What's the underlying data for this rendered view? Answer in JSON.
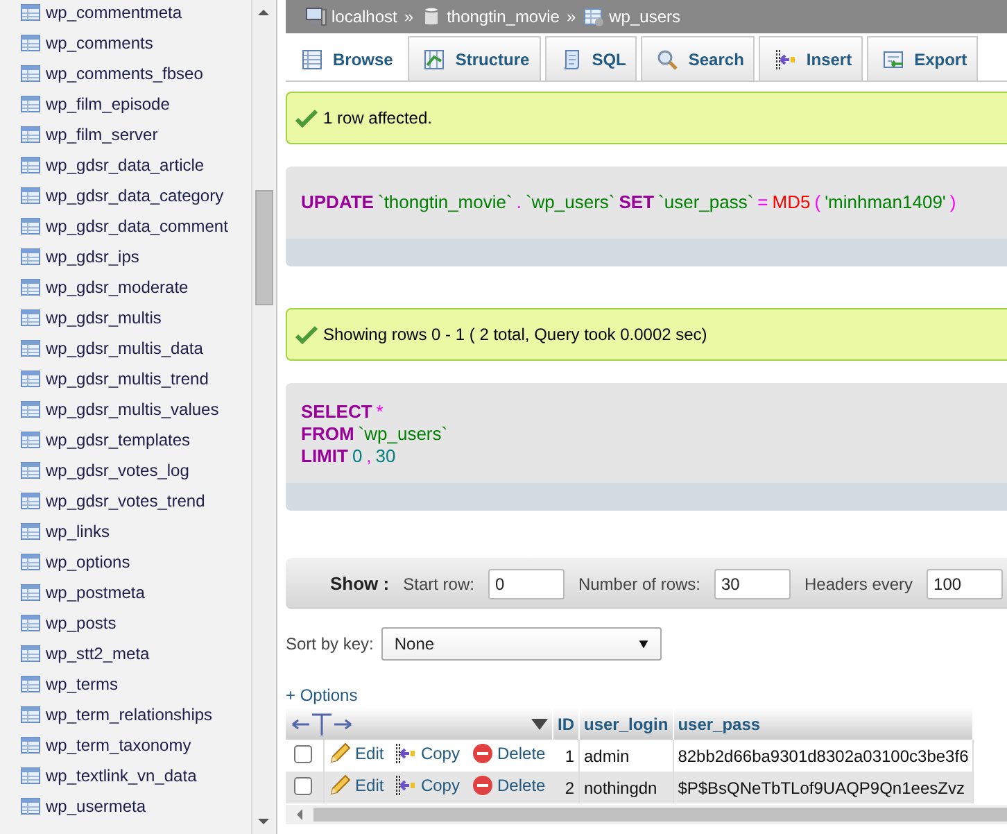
{
  "sidebar": {
    "items": [
      {
        "label": "wp_commentmeta"
      },
      {
        "label": "wp_comments"
      },
      {
        "label": "wp_comments_fbseo"
      },
      {
        "label": "wp_film_episode"
      },
      {
        "label": "wp_film_server"
      },
      {
        "label": "wp_gdsr_data_article"
      },
      {
        "label": "wp_gdsr_data_category"
      },
      {
        "label": "wp_gdsr_data_comment"
      },
      {
        "label": "wp_gdsr_ips"
      },
      {
        "label": "wp_gdsr_moderate"
      },
      {
        "label": "wp_gdsr_multis"
      },
      {
        "label": "wp_gdsr_multis_data"
      },
      {
        "label": "wp_gdsr_multis_trend"
      },
      {
        "label": "wp_gdsr_multis_values"
      },
      {
        "label": "wp_gdsr_templates"
      },
      {
        "label": "wp_gdsr_votes_log"
      },
      {
        "label": "wp_gdsr_votes_trend"
      },
      {
        "label": "wp_links"
      },
      {
        "label": "wp_options"
      },
      {
        "label": "wp_postmeta"
      },
      {
        "label": "wp_posts"
      },
      {
        "label": "wp_stt2_meta"
      },
      {
        "label": "wp_terms"
      },
      {
        "label": "wp_term_relationships"
      },
      {
        "label": "wp_term_taxonomy"
      },
      {
        "label": "wp_textlink_vn_data"
      },
      {
        "label": "wp_usermeta"
      }
    ]
  },
  "breadcrumb": [
    {
      "kind": "server",
      "label": "localhost"
    },
    {
      "kind": "database",
      "label": "thongtin_movie"
    },
    {
      "kind": "table",
      "label": "wp_users"
    }
  ],
  "breadcrumb_separator": "»",
  "tabs": [
    {
      "kind": "browse",
      "label": "Browse",
      "selected": true
    },
    {
      "kind": "structure",
      "label": "Structure",
      "selected": false
    },
    {
      "kind": "sql",
      "label": "SQL",
      "selected": false
    },
    {
      "kind": "search",
      "label": "Search",
      "selected": false
    },
    {
      "kind": "insert",
      "label": "Insert",
      "selected": false
    },
    {
      "kind": "export",
      "label": "Export",
      "selected": false
    }
  ],
  "update_message": "1 row affected.",
  "update_query": [
    [
      {
        "kind": "keyword",
        "text": "UPDATE"
      },
      {
        "kind": "ident",
        "text": "`thongtin_movie`"
      },
      {
        "kind": "punct",
        "text": "."
      },
      {
        "kind": "ident",
        "text": "`wp_users`"
      },
      {
        "kind": "keyword",
        "text": "SET"
      },
      {
        "kind": "ident",
        "text": "`user_pass`"
      },
      {
        "kind": "operator",
        "text": "="
      },
      {
        "kind": "function",
        "text": "MD5"
      },
      {
        "kind": "punct",
        "text": "("
      },
      {
        "kind": "string",
        "text": "'minhman1409'"
      },
      {
        "kind": "punct",
        "text": ")"
      }
    ]
  ],
  "select_message": "Showing rows 0 - 1 ( 2 total, Query took 0.0002 sec)",
  "select_query": [
    [
      {
        "kind": "keyword",
        "text": "SELECT"
      },
      {
        "kind": "operator",
        "text": "*"
      }
    ],
    [
      {
        "kind": "keyword",
        "text": "FROM"
      },
      {
        "kind": "ident",
        "text": "`wp_users`"
      }
    ],
    [
      {
        "kind": "keyword",
        "text": "LIMIT"
      },
      {
        "kind": "number",
        "text": "0"
      },
      {
        "kind": "punct",
        "text": ","
      },
      {
        "kind": "number",
        "text": "30"
      }
    ]
  ],
  "show_bar": {
    "label": "Show :",
    "start_row_label": "Start row:",
    "start_row": "0",
    "rows_label": "Number of rows:",
    "rows": "30",
    "headers_label": "Headers every",
    "headers": "100"
  },
  "sort": {
    "label": "Sort by key:",
    "value": "None"
  },
  "options_link": "+ Options",
  "table": {
    "columns": [
      "ID",
      "user_login",
      "user_pass"
    ],
    "rows": [
      {
        "checked": false,
        "edit": "Edit",
        "copy": "Copy",
        "delete": "Delete",
        "cells": [
          "1",
          "admin",
          "82bb2d66ba9301d8302a03100c3be3f6"
        ]
      },
      {
        "checked": false,
        "edit": "Edit",
        "copy": "Copy",
        "delete": "Delete",
        "cells": [
          "2",
          "nothingdn",
          "$P$BsQNeTbTLof9UAQP9Qn1eesZvz"
        ]
      }
    ]
  }
}
